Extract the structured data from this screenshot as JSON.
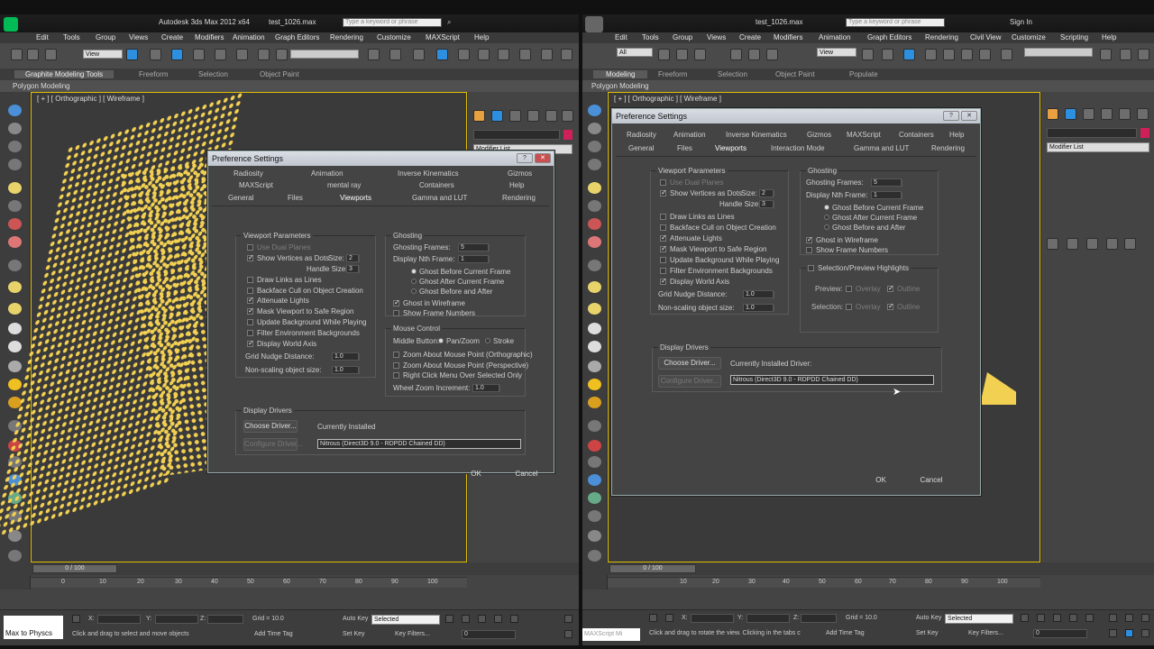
{
  "left": {
    "title": "Autodesk 3ds Max  2012 x64",
    "file": "test_1026.max",
    "search_placeholder": "Type a keyword or phrase",
    "menu": [
      "Edit",
      "Tools",
      "Group",
      "Views",
      "Create",
      "Modifiers",
      "Animation",
      "Graph Editors",
      "Rendering",
      "Customize",
      "MAXScript",
      "Help"
    ],
    "view_select": "View",
    "ribbon_tabs": [
      "Graphite Modeling Tools",
      "Freeform",
      "Selection",
      "Object Paint"
    ],
    "ribbon_sub": "Polygon Modeling",
    "viewport_label": "[ + ] [ Orthographic ] [ Wireframe ]",
    "modifier_list": "Modifier List",
    "time": "0 / 100",
    "ticks": [
      "0",
      "10",
      "20",
      "30",
      "40",
      "50",
      "60",
      "70",
      "80",
      "90",
      "100"
    ],
    "x_label": "X:",
    "y_label": "Y:",
    "z_label": "Z:",
    "grid": "Grid = 10.0",
    "auto_key": "Auto Key",
    "selected": "Selected",
    "set_key": "Set Key",
    "key_filters": "Key Filters...",
    "frame": "0",
    "status_msg": "Click and drag to select and move objects",
    "add_time_tag": "Add Time Tag",
    "maxscript": "Max to Physcs"
  },
  "right": {
    "file": "test_1026.max",
    "search_placeholder": "Type a keyword or phrase",
    "sign_in": "Sign In",
    "menu": [
      "Edit",
      "Tools",
      "Group",
      "Views",
      "Create",
      "Modifiers",
      "Animation",
      "Graph Editors",
      "Rendering",
      "Civil View",
      "Customize",
      "Scripting",
      "Help"
    ],
    "all_select": "All",
    "view_select": "View",
    "ribbon_tabs": [
      "Modeling",
      "Freeform",
      "Selection",
      "Object Paint",
      "Populate"
    ],
    "ribbon_sub": "Polygon Modeling",
    "viewport_label": "[ + ] [ Orthographic ] [ Wireframe ]",
    "modifier_list": "Modifier List",
    "time": "0 / 100",
    "ticks": [
      "10",
      "20",
      "30",
      "40",
      "50",
      "60",
      "70",
      "80",
      "90",
      "100"
    ],
    "x_label": "X:",
    "y_label": "Y:",
    "z_label": "Z:",
    "grid": "Grid = 10.0",
    "auto_key": "Auto Key",
    "selected": "Selected",
    "set_key": "Set Key",
    "key_filters": "Key Filters...",
    "frame": "0",
    "status_msg": "Click and drag to rotate the view.  Clicking in the tabs c",
    "add_time_tag": "Add Time Tag",
    "maxscript": "MAXScript Mi"
  },
  "dlgL": {
    "title": "Preference Settings",
    "tabs1": [
      "Radiosity",
      "Animation",
      "Inverse Kinematics",
      "Gizmos"
    ],
    "tabs2": [
      "MAXScript",
      "mental ray",
      "Containers",
      "Help"
    ],
    "tabs3": [
      "General",
      "Files",
      "Viewports",
      "Gamma and LUT",
      "Rendering"
    ],
    "vp_title": "Viewport Parameters",
    "use_dual": "Use Dual Planes",
    "show_verts": "Show Vertices as Dots",
    "size": "Size:",
    "size_val": "2",
    "handle": "Handle Size:",
    "handle_val": "3",
    "draw_links": "Draw Links as Lines",
    "backface": "Backface Cull on Object Creation",
    "attenuate": "Attenuate Lights",
    "mask": "Mask Viewport to Safe Region",
    "update_bg": "Update Background While Playing",
    "filter_env": "Filter Environment Backgrounds",
    "display_axis": "Display World Axis",
    "grid_nudge": "Grid Nudge Distance:",
    "grid_nudge_val": "1.0",
    "nonscale": "Non-scaling object size:",
    "nonscale_val": "1.0",
    "gh_title": "Ghosting",
    "gh_frames": "Ghosting Frames:",
    "gh_frames_val": "5",
    "gh_nth": "Display Nth Frame:",
    "gh_nth_val": "1",
    "gh_before": "Ghost Before Current Frame",
    "gh_after": "Ghost After Current Frame",
    "gh_ba": "Ghost Before and After",
    "gh_wire": "Ghost in Wireframe",
    "gh_show": "Show Frame Numbers",
    "mc_title": "Mouse Control",
    "mc_middle": "Middle Button:",
    "mc_pan": "Pan/Zoom",
    "mc_stroke": "Stroke",
    "mc_zoom_o": "Zoom About Mouse Point (Orthographic)",
    "mc_zoom_p": "Zoom About Mouse Point (Perspective)",
    "mc_right": "Right Click Menu Over Selected Only",
    "mc_wheel": "Wheel Zoom Increment:",
    "mc_wheel_val": "1.0",
    "dd_title": "Display Drivers",
    "choose": "Choose Driver...",
    "installed": "Currently Installed",
    "configure": "Configure Driver...",
    "driver": "Nitrous (Direct3D 9.0 - RDPDD Chained DD)",
    "ok": "OK",
    "cancel": "Cancel"
  },
  "dlgR": {
    "title": "Preference Settings",
    "tabs1": [
      "Radiosity",
      "Animation",
      "Inverse Kinematics",
      "Gizmos",
      "MAXScript",
      "Containers",
      "Help"
    ],
    "tabs2": [
      "General",
      "Files",
      "Viewports",
      "Interaction Mode",
      "Gamma and LUT",
      "Rendering"
    ],
    "vp_title": "Viewport Parameters",
    "use_dual": "Use Dual Planes",
    "show_verts": "Show Vertices as Dots",
    "size": "Size:",
    "size_val": "2",
    "handle": "Handle Size:",
    "handle_val": "3",
    "draw_links": "Draw Links as Lines",
    "backface": "Backface Cull on Object Creation",
    "attenuate": "Attenuate Lights",
    "mask": "Mask Viewport to Safe Region",
    "update_bg": "Update Background While Playing",
    "filter_env": "Filter Environment Backgrounds",
    "display_axis": "Display World Axis",
    "grid_nudge": "Grid Nudge Distance:",
    "grid_nudge_val": "1.0",
    "nonscale": "Non-scaling object size:",
    "nonscale_val": "1.0",
    "gh_title": "Ghosting",
    "gh_frames": "Ghosting Frames:",
    "gh_frames_val": "5",
    "gh_nth": "Display Nth Frame:",
    "gh_nth_val": "1",
    "gh_before": "Ghost Before Current Frame",
    "gh_after": "Ghost After Current Frame",
    "gh_ba": "Ghost Before and After",
    "gh_wire": "Ghost in Wireframe",
    "gh_show": "Show Frame Numbers",
    "sp_title": "Selection/Preview Highlights",
    "preview": "Preview:",
    "selection": "Selection:",
    "overlay": "Overlay",
    "outline": "Outline",
    "dd_title": "Display Drivers",
    "choose": "Choose Driver...",
    "installed": "Currently Installed Driver:",
    "configure": "Configure Driver...",
    "driver": "Nitrous (Direct3D 9.0 - RDPDD Chained DD)",
    "ok": "OK",
    "cancel": "Cancel"
  }
}
